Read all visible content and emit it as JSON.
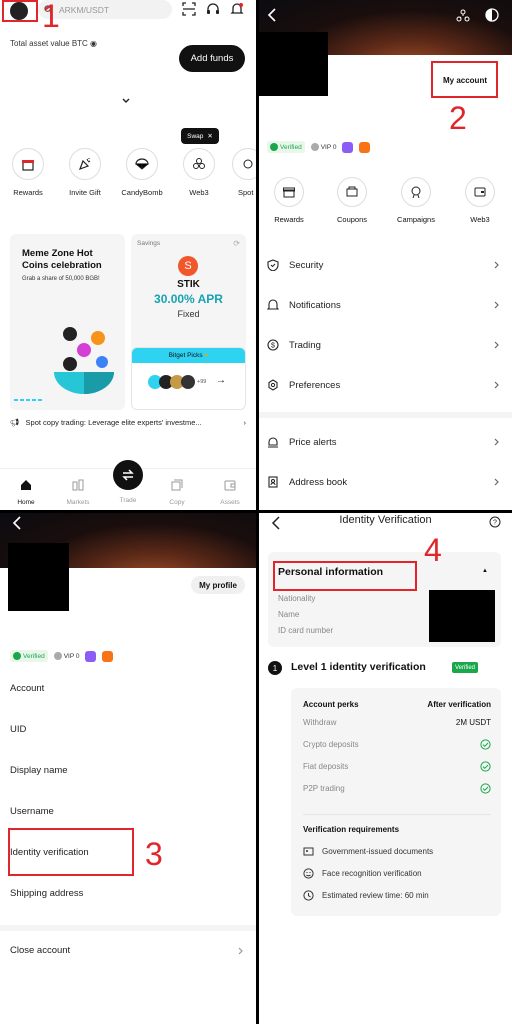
{
  "panel1": {
    "search_placeholder": "ARKM/USDT",
    "total_label": "Total asset value BTC",
    "add_funds": "Add funds",
    "swap_tip": "Swap",
    "quick_actions": [
      "Rewards",
      "Invite Gift",
      "CandyBomb",
      "Web3",
      "Spot"
    ],
    "card_meme_title": "Meme Zone Hot Coins celebration",
    "card_meme_sub": "Grab a share of 50,000 BGB!",
    "card_savings_label": "Savings",
    "card_savings_coin": "STIK",
    "card_savings_apr": "30.00% APR",
    "card_savings_type": "Fixed",
    "bitget_picks": "Bitget Picks",
    "picks_more": "+99",
    "announcement": "Spot copy trading: Leverage elite experts' investme...",
    "bottom_nav": [
      "Home",
      "Markets",
      "Trade",
      "Copy",
      "Assets"
    ],
    "step": "1"
  },
  "panel2": {
    "my_account": "My account",
    "verified": "Verified",
    "vip": "VIP 0",
    "quick": [
      "Rewards",
      "Coupons",
      "Campaigns",
      "Web3"
    ],
    "menu": [
      "Security",
      "Notifications",
      "Trading",
      "Preferences",
      "Price alerts",
      "Address book"
    ],
    "step": "2"
  },
  "panel3": {
    "my_profile": "My profile",
    "verified": "Verified",
    "vip": "VIP 0",
    "rows": [
      "Account",
      "UID",
      "Display name",
      "Username",
      "Identity verification",
      "Shipping address",
      "Close account"
    ],
    "step": "3"
  },
  "panel4": {
    "title": "Identity Verification",
    "personal_info": "Personal information",
    "fields": [
      "Nationality",
      "Name",
      "ID card number"
    ],
    "level_num": "1",
    "level_title": "Level 1 identity verification",
    "level_badge": "Verified",
    "perks_head": "Account perks",
    "after_head": "After verification",
    "withdraw_label": "Withdraw",
    "withdraw_value": "2M USDT",
    "perk_rows": [
      "Crypto deposits",
      "Fiat deposits",
      "P2P trading"
    ],
    "req_head": "Verification requirements",
    "reqs": [
      "Government-issued documents",
      "Face recognition verification",
      "Estimated review time: 60 min"
    ],
    "step": "4"
  },
  "colors": {
    "accent_red": "#e0262b",
    "verified_green": "#1aa64a",
    "cyan": "#2ed3f2"
  }
}
